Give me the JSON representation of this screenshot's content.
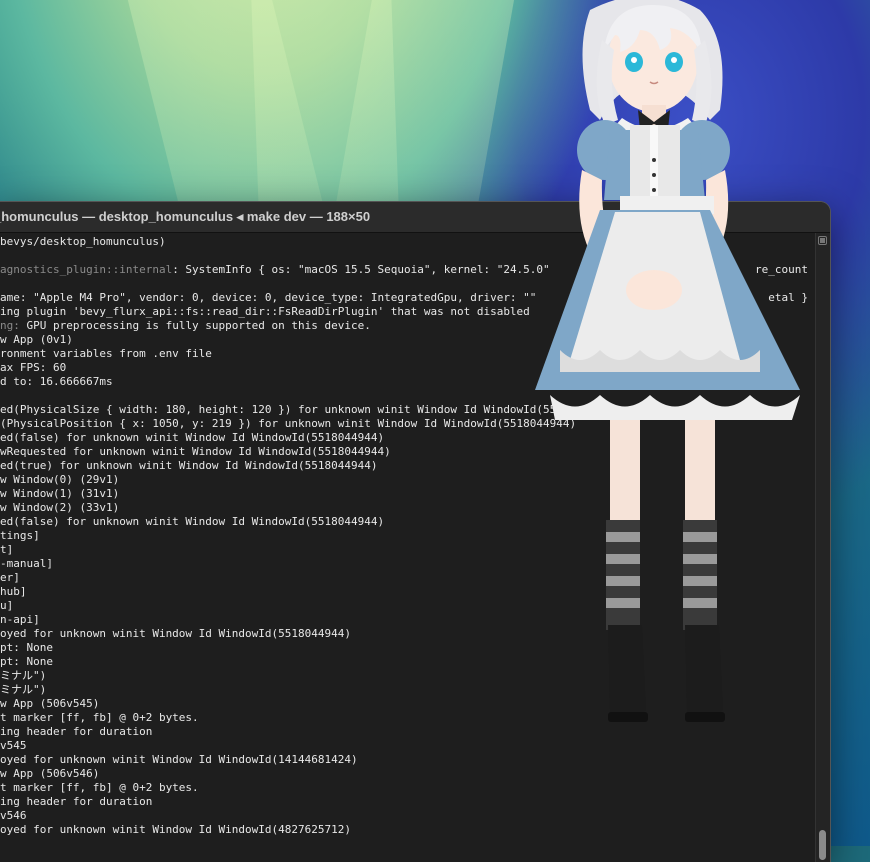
{
  "window": {
    "title": "_homunculus — desktop_homunculus ◂ make dev — 188×50"
  },
  "terminal": {
    "lines": [
      {
        "text": "bevys/desktop_homunculus)",
        "dim_prefix": ""
      },
      {
        "text": "",
        "dim_prefix": ""
      },
      {
        "text": ": SystemInfo { os: \"macOS 15.5 Sequoia\", kernel: \"24.5.0\"",
        "dim_prefix": "agnostics_plugin::internal",
        "tail": "re_count"
      },
      {
        "text": "",
        "dim_prefix": ""
      },
      {
        "text": "ame: \"Apple M4 Pro\", vendor: 0, device: 0, device_type: IntegratedGpu, driver: \"\"",
        "dim_prefix": "",
        "tail": "etal }"
      },
      {
        "text": "ing plugin 'bevy_flurx_api::fs::read_dir::FsReadDirPlugin' that was not disabled",
        "dim_prefix": ""
      },
      {
        "text": " GPU preprocessing is fully supported on this device.",
        "dim_prefix": "ng:"
      },
      {
        "text": "w App (0v1)",
        "dim_prefix": ""
      },
      {
        "text": "ronment variables from .env file",
        "dim_prefix": ""
      },
      {
        "text": "ax FPS: 60",
        "dim_prefix": ""
      },
      {
        "text": "d to: 16.666667ms",
        "dim_prefix": ""
      },
      {
        "text": "",
        "dim_prefix": ""
      },
      {
        "text": "ed(PhysicalSize { width: 180, height: 120 }) for unknown winit Window Id WindowId(551",
        "dim_prefix": ""
      },
      {
        "text": "(PhysicalPosition { x: 1050, y: 219 }) for unknown winit Window Id WindowId(5518044944)",
        "dim_prefix": ""
      },
      {
        "text": "ed(false) for unknown winit Window Id WindowId(5518044944)",
        "dim_prefix": ""
      },
      {
        "text": "wRequested for unknown winit Window Id WindowId(5518044944)",
        "dim_prefix": ""
      },
      {
        "text": "ed(true) for unknown winit Window Id WindowId(5518044944)",
        "dim_prefix": ""
      },
      {
        "text": "w Window(0) (29v1)",
        "dim_prefix": ""
      },
      {
        "text": "w Window(1) (31v1)",
        "dim_prefix": ""
      },
      {
        "text": "w Window(2) (33v1)",
        "dim_prefix": ""
      },
      {
        "text": "ed(false) for unknown winit Window Id WindowId(5518044944)",
        "dim_prefix": ""
      },
      {
        "text": "tings]",
        "dim_prefix": ""
      },
      {
        "text": "t]",
        "dim_prefix": ""
      },
      {
        "text": "-manual]",
        "dim_prefix": ""
      },
      {
        "text": "er]",
        "dim_prefix": ""
      },
      {
        "text": "hub]",
        "dim_prefix": ""
      },
      {
        "text": "u]",
        "dim_prefix": ""
      },
      {
        "text": "n-api]",
        "dim_prefix": ""
      },
      {
        "text": "oyed for unknown winit Window Id WindowId(5518044944)",
        "dim_prefix": ""
      },
      {
        "text": "pt: None",
        "dim_prefix": ""
      },
      {
        "text": "pt: None",
        "dim_prefix": ""
      },
      {
        "text": "ミナル\")",
        "dim_prefix": ""
      },
      {
        "text": "ミナル\")",
        "dim_prefix": ""
      },
      {
        "text": "w App (506v545)",
        "dim_prefix": ""
      },
      {
        "text": "t marker [ff, fb] @ 0+2 bytes.",
        "dim_prefix": ""
      },
      {
        "text": "ing header for duration",
        "dim_prefix": ""
      },
      {
        "text": "v545",
        "dim_prefix": ""
      },
      {
        "text": "oyed for unknown winit Window Id WindowId(14144681424)",
        "dim_prefix": ""
      },
      {
        "text": "w App (506v546)",
        "dim_prefix": ""
      },
      {
        "text": "t marker [ff, fb] @ 0+2 bytes.",
        "dim_prefix": ""
      },
      {
        "text": "ing header for duration",
        "dim_prefix": ""
      },
      {
        "text": "v546",
        "dim_prefix": ""
      },
      {
        "text": "oyed for unknown winit Window Id WindowId(4827625712)",
        "dim_prefix": ""
      }
    ]
  },
  "colors": {
    "terminal_bg": "#1e1e1e",
    "text": "#e8e8e8",
    "dim_text": "#8a8a8a",
    "dress_blue": "#7fa7c8",
    "apron": "#e9e9e9"
  },
  "icons": {
    "mascot": "anime-maid-character-icon",
    "scroll_up": "scroll-up-icon"
  }
}
